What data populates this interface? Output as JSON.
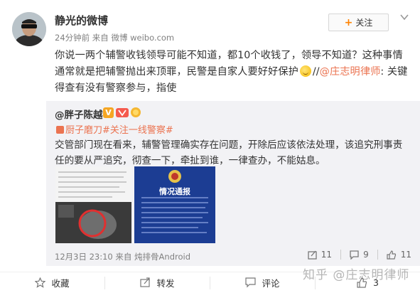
{
  "user": {
    "name": "静光的微博",
    "meta": "24分钟前 来自 微博 weibo.com",
    "follow_label": "关注"
  },
  "post": {
    "text_before": "你说一两个辅警收钱领导可能不知道，都10个收钱了，领导不知道？这种事情通常就是把辅警抛出来顶罪，民警是自家人要好好保护",
    "text_sep": "//",
    "mention": "@庄志明律师",
    "text_after": ": 关键得查有没有警察参与，指使",
    "emoji": "dizzy-face"
  },
  "repost": {
    "author": "@胖子陈越",
    "tags": "厨子磨刀#关注一线警察#",
    "text": "交管部门现在看来，辅警管理确实存在问题，开除后应该依法处理，该追究刑事责任的要从严追究，彻查一下，牵扯到谁，一律查办，不能姑息。",
    "image2_title": "情况通报",
    "timestamp": "12月3日 23:10 来自 炖排骨Android",
    "shares": "11",
    "comments": "9",
    "likes": "11"
  },
  "actions": {
    "favorite": "收藏",
    "repost": "转发",
    "comment": "评论",
    "like": "3"
  },
  "watermark": "知乎 @庄志明律师",
  "colors": {
    "accent": "#ff8200",
    "link": "#eb7350",
    "repost_bg": "#f2f2f5"
  }
}
